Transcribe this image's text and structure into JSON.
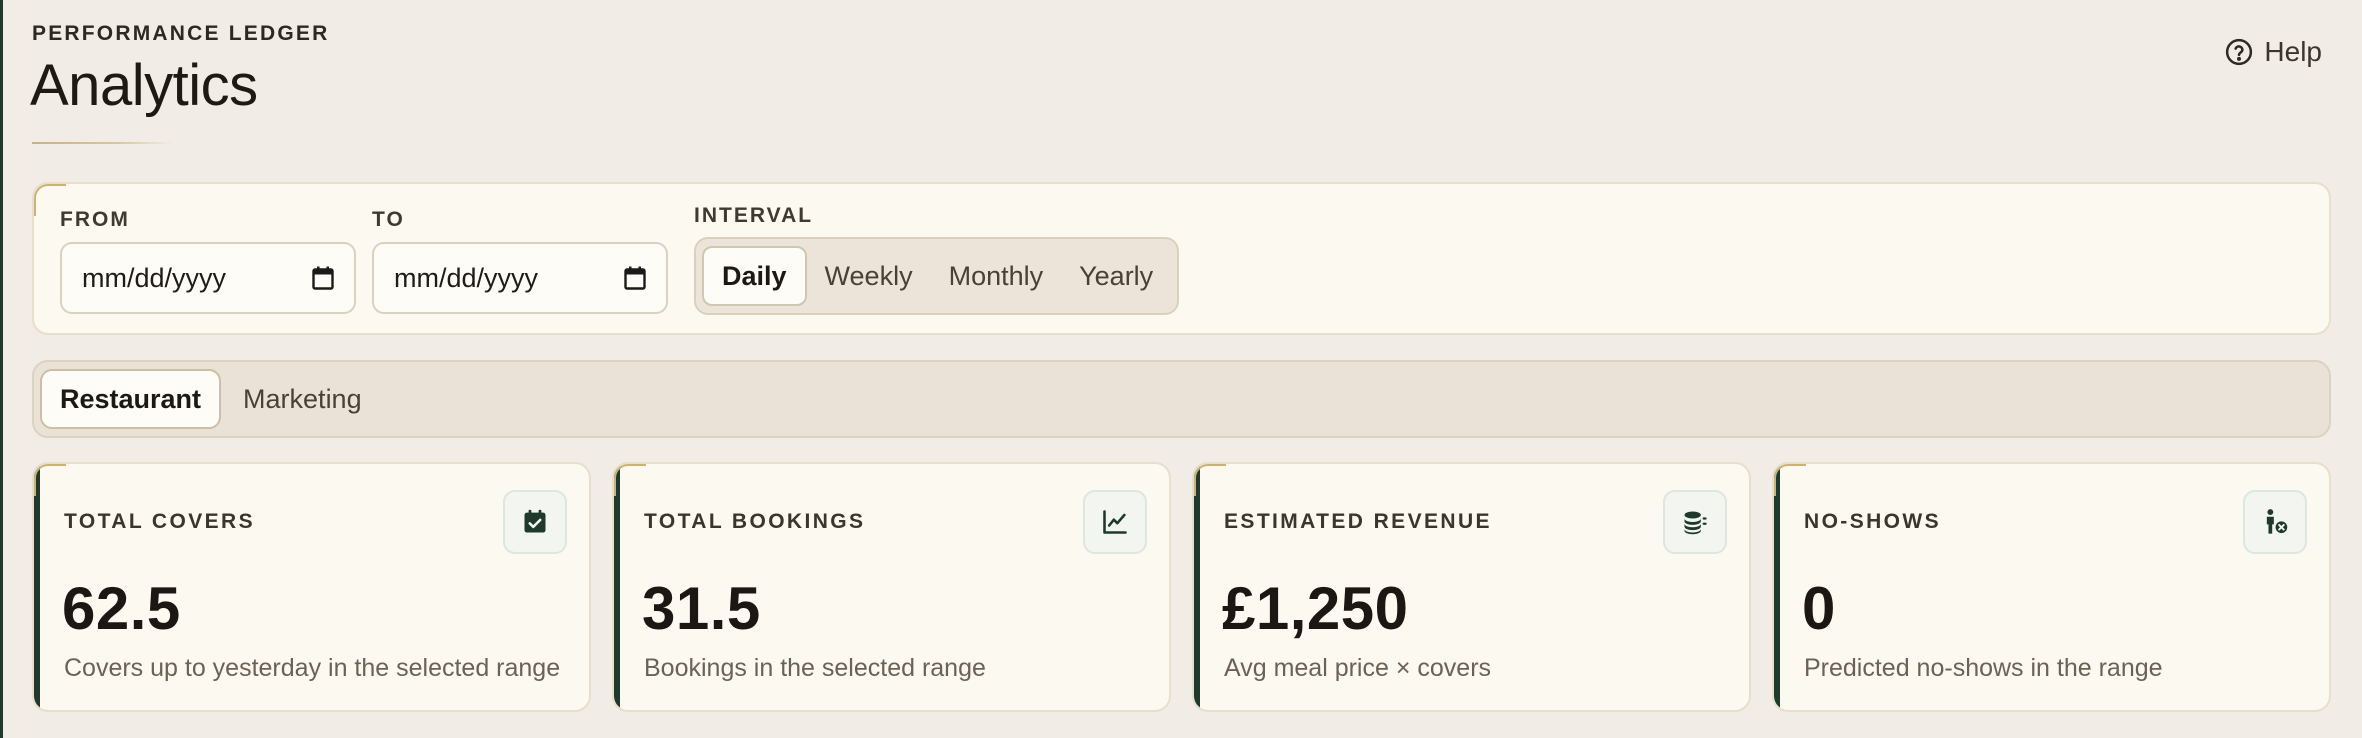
{
  "header": {
    "eyebrow": "PERFORMANCE LEDGER",
    "title": "Analytics",
    "help_label": "Help"
  },
  "filters": {
    "from_label": "FROM",
    "from_placeholder": "mm/dd/yyyy",
    "to_label": "TO",
    "to_placeholder": "mm/dd/yyyy",
    "interval_label": "INTERVAL",
    "intervals": [
      {
        "label": "Daily",
        "active": true
      },
      {
        "label": "Weekly",
        "active": false
      },
      {
        "label": "Monthly",
        "active": false
      },
      {
        "label": "Yearly",
        "active": false
      }
    ]
  },
  "tabs": [
    {
      "label": "Restaurant",
      "active": true
    },
    {
      "label": "Marketing",
      "active": false
    }
  ],
  "cards": [
    {
      "title": "TOTAL COVERS",
      "value": "62.5",
      "description": "Covers up to yesterday in the selected range",
      "icon": "calendar-check-icon"
    },
    {
      "title": "TOTAL BOOKINGS",
      "value": "31.5",
      "description": "Bookings in the selected range",
      "icon": "line-chart-icon"
    },
    {
      "title": "ESTIMATED REVENUE",
      "value": "£1,250",
      "description": "Avg meal price × covers",
      "icon": "coins-icon"
    },
    {
      "title": "NO-SHOWS",
      "value": "0",
      "description": "Predicted no-shows in the range",
      "icon": "person-cancel-icon"
    }
  ],
  "colors": {
    "background": "#f1ece6",
    "panel": "#fbf9f0",
    "accent_green": "#1f3a2c",
    "accent_gold": "#c9b37a"
  }
}
